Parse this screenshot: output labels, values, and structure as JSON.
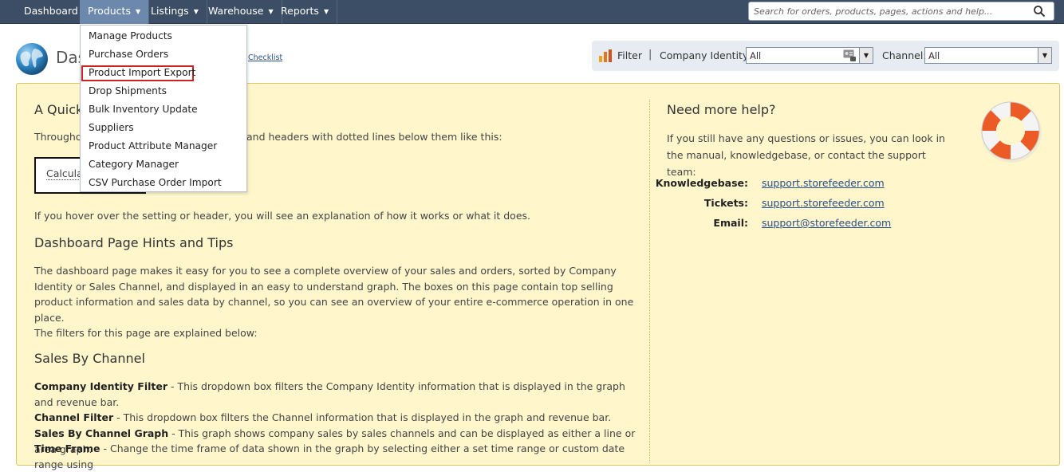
{
  "nav": {
    "items": [
      {
        "label": "Dashboard",
        "has_caret": false
      },
      {
        "label": "Products",
        "has_caret": true,
        "active": true
      },
      {
        "label": "Listings",
        "has_caret": true
      },
      {
        "label": "Warehouse",
        "has_caret": true
      },
      {
        "label": "Reports",
        "has_caret": true
      }
    ],
    "caret": "▼",
    "search_placeholder": "Search for orders, products, pages, actions and help...",
    "search_icon": "search-icon"
  },
  "products_menu": {
    "items": [
      "Manage Products",
      "Purchase Orders",
      "Product Import Export",
      "Drop Shipments",
      "Bulk Inventory Update",
      "Suppliers",
      "Product Attribute Manager",
      "Category Manager",
      "CSV Purchase Order Import"
    ],
    "highlighted": "Product Import Export",
    "highlight_color": "#cc2222"
  },
  "header": {
    "title_visible": "Das",
    "checklist_link": "Checklist"
  },
  "filter": {
    "label": "Filter",
    "separator": "|",
    "company_identity_label": "Company Identity:",
    "company_identity_value": "All",
    "channel_label": "Channel:",
    "channel_value": "All",
    "select_caret": "▼"
  },
  "help": {
    "quick_title": "A Quick",
    "quick_text_start": "Througho",
    "quick_text_end": "and headers with dotted lines below them like this:",
    "calc_example": "Calculat",
    "hover_text": "If you hover over the setting or header, you will see an explanation of how it works or what it does.",
    "dashboard_title": "Dashboard Page Hints and Tips",
    "dashboard_text": "The dashboard page makes it easy for you to see a complete overview of your sales and orders, sorted by Company Identity or Sales Channel, and displayed in an easy to understand graph. The boxes on this page contain top selling product information and sales data by channel, so you can see an overview of your entire e-commerce operation in one place.",
    "filters_text": "The filters for this page are explained below:",
    "sales_channel_title": "Sales By Channel",
    "definitions": [
      {
        "term": "Company Identity Filter",
        "text": " - This dropdown box filters the Company Identity information that is displayed in the graph and revenue bar."
      },
      {
        "term": "Channel Filter",
        "text": " - This dropdown box filters the Channel information that is displayed in the graph and revenue bar."
      },
      {
        "term": "Sales By Channel Graph",
        "text": " - This graph shows company sales by sales channels and can be displayed as either a line or area graph."
      },
      {
        "term": "Time Frame",
        "text": " - Change the time frame of data shown in the graph by selecting either a set time range or custom date range using"
      }
    ]
  },
  "support": {
    "title": "Need more help?",
    "text": "If you still have any questions or issues, you can look in the manual, knowledgebase, or contact the support team:",
    "rows": [
      {
        "label": "Knowledgebase:",
        "value": "support.storefeeder.com"
      },
      {
        "label": "Tickets:",
        "value": "support.storefeeder.com"
      },
      {
        "label": "Email:",
        "value": "support@storefeeder.com"
      }
    ]
  }
}
